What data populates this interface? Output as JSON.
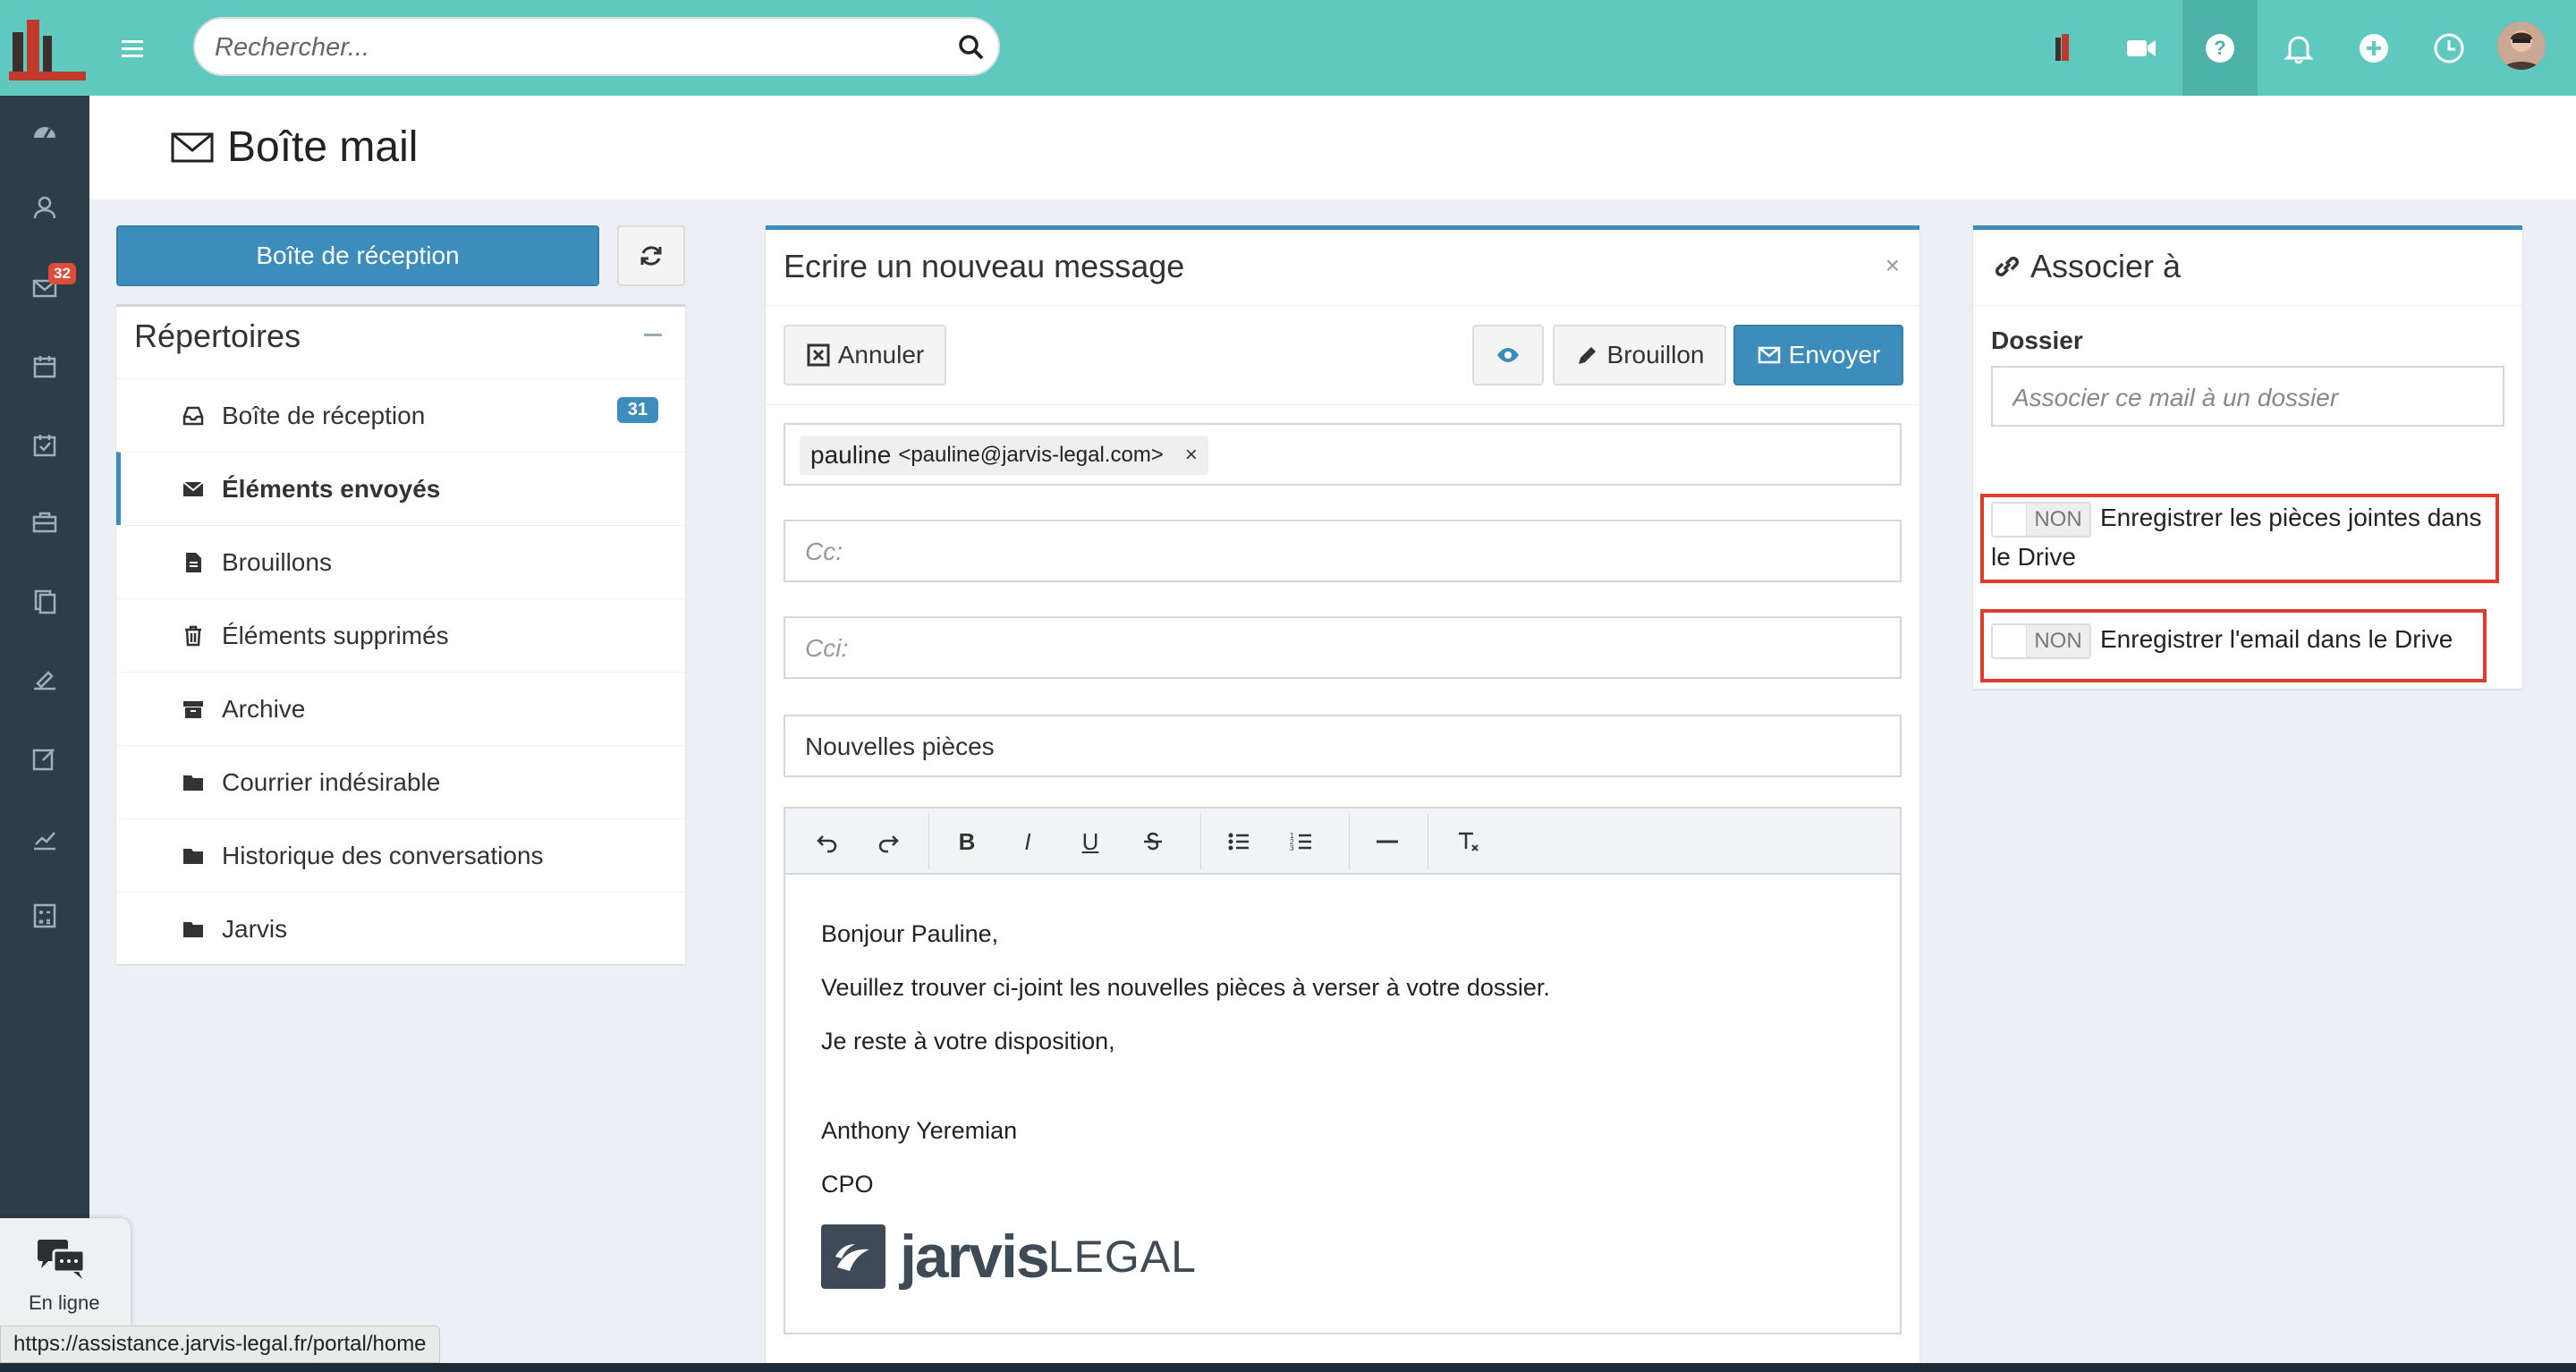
{
  "header": {
    "search_placeholder": "Rechercher...",
    "icons": [
      "jarvis-logo-icon",
      "video-icon",
      "help-icon",
      "bell-icon",
      "plus-circle-icon",
      "clock-icon"
    ]
  },
  "sidebar": {
    "icons": [
      "dashboard-icon",
      "contacts-icon",
      "mail-icon",
      "calendar-icon",
      "tasks-icon",
      "briefcase-icon",
      "documents-icon",
      "signature-icon",
      "edit-icon",
      "chart-icon",
      "calculator-icon"
    ],
    "mail_badge": "32"
  },
  "page": {
    "title": "Boîte mail"
  },
  "left": {
    "inbox_button": "Boîte de réception",
    "folders_title": "Répertoires",
    "folders": [
      {
        "label": "Boîte de réception",
        "icon": "inbox-icon",
        "badge": "31"
      },
      {
        "label": "Éléments envoyés",
        "icon": "envelope-icon",
        "active": true
      },
      {
        "label": "Brouillons",
        "icon": "file-icon"
      },
      {
        "label": "Éléments supprimés",
        "icon": "trash-icon"
      },
      {
        "label": "Archive",
        "icon": "archive-icon"
      },
      {
        "label": "Courrier indésirable",
        "icon": "folder-icon"
      },
      {
        "label": "Historique des conversations",
        "icon": "folder-icon"
      },
      {
        "label": "Jarvis",
        "icon": "folder-icon"
      }
    ]
  },
  "compose": {
    "title": "Ecrire un nouveau message",
    "close": "×",
    "cancel": "Annuler",
    "draft": "Brouillon",
    "send": "Envoyer",
    "to_name": "pauline",
    "to_addr": "<pauline@jarvis-legal.com>",
    "to_remove": "×",
    "cc_placeholder": "Cc:",
    "bcc_placeholder": "Cci:",
    "subject": "Nouvelles pièces",
    "toolbar": {
      "underline": "U",
      "bold": "B",
      "italic": "I"
    },
    "body": {
      "l1": "Bonjour Pauline,",
      "l2": "Veuillez trouver ci-joint les nouvelles pièces à verser à votre dossier.",
      "l3": "Je reste à votre disposition,",
      "l4": "Anthony Yeremian",
      "l5": "CPO"
    },
    "signature_logo": {
      "word": "jarvis",
      "suffix": "LEGAL"
    }
  },
  "associate": {
    "title": "Associer à",
    "folder_label": "Dossier",
    "folder_placeholder": "Associer ce mail à un dossier",
    "toggle_off": "NON",
    "opt1": "Enregistrer les pièces jointes dans le Drive",
    "opt2": "Enregistrer l'email dans le Drive"
  },
  "chat": {
    "label": "En ligne"
  },
  "status_url": "https://assistance.jarvis-legal.fr/portal/home"
}
